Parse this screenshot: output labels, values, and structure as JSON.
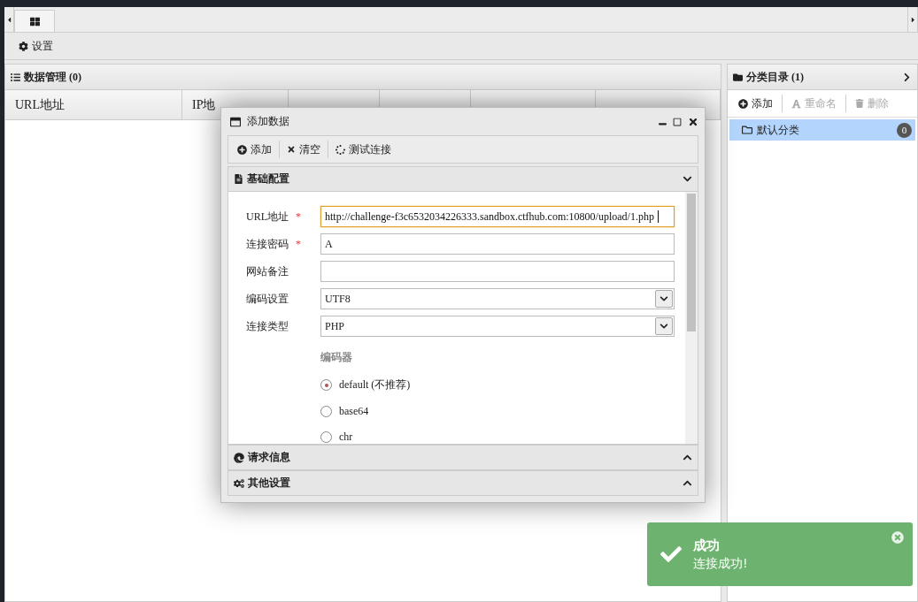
{
  "toolbar": {
    "settings_button": "设置"
  },
  "data_panel": {
    "title": "数据管理 (0)",
    "columns": [
      "URL地址",
      "IP地"
    ]
  },
  "category_panel": {
    "title": "分类目录 (1)",
    "buttons": [
      {
        "kind": "add",
        "label": "添加",
        "disabled": false
      },
      {
        "kind": "rename",
        "label": "重命名",
        "disabled": true
      },
      {
        "kind": "delete",
        "label": "删除",
        "disabled": true
      }
    ],
    "items": [
      {
        "name": "默认分类",
        "count": "0",
        "selected": true
      }
    ]
  },
  "dialog": {
    "title": "添加数据",
    "toolbar": [
      {
        "kind": "add",
        "label": "添加"
      },
      {
        "kind": "clear",
        "label": "清空"
      },
      {
        "kind": "test",
        "label": "测试连接"
      }
    ],
    "sections": [
      {
        "kind": "basic",
        "title": "基础配置",
        "expanded": true
      },
      {
        "kind": "request",
        "title": "请求信息",
        "expanded": false
      },
      {
        "kind": "other",
        "title": "其他设置",
        "expanded": false
      }
    ],
    "fields": [
      {
        "kind": "text",
        "label": "URL地址",
        "required_mark": "*",
        "value": "http://challenge-f3c6532034226333.sandbox.ctfhub.com:10800/upload/1.php",
        "focused": true
      },
      {
        "kind": "text",
        "label": "连接密码",
        "required_mark": "*",
        "value": "A",
        "focused": false
      },
      {
        "kind": "text",
        "label": "网站备注",
        "focused": false
      },
      {
        "kind": "select",
        "label": "编码设置",
        "value": "UTF8"
      },
      {
        "kind": "select",
        "label": "连接类型",
        "value": "PHP"
      }
    ],
    "encoder": {
      "label": "编码器",
      "options": [
        {
          "label": "default (不推荐)",
          "selected": true
        },
        {
          "label": "base64",
          "selected": false
        },
        {
          "label": "chr",
          "selected": false
        }
      ]
    }
  },
  "toast": {
    "title": "成功",
    "message": "连接成功!"
  }
}
